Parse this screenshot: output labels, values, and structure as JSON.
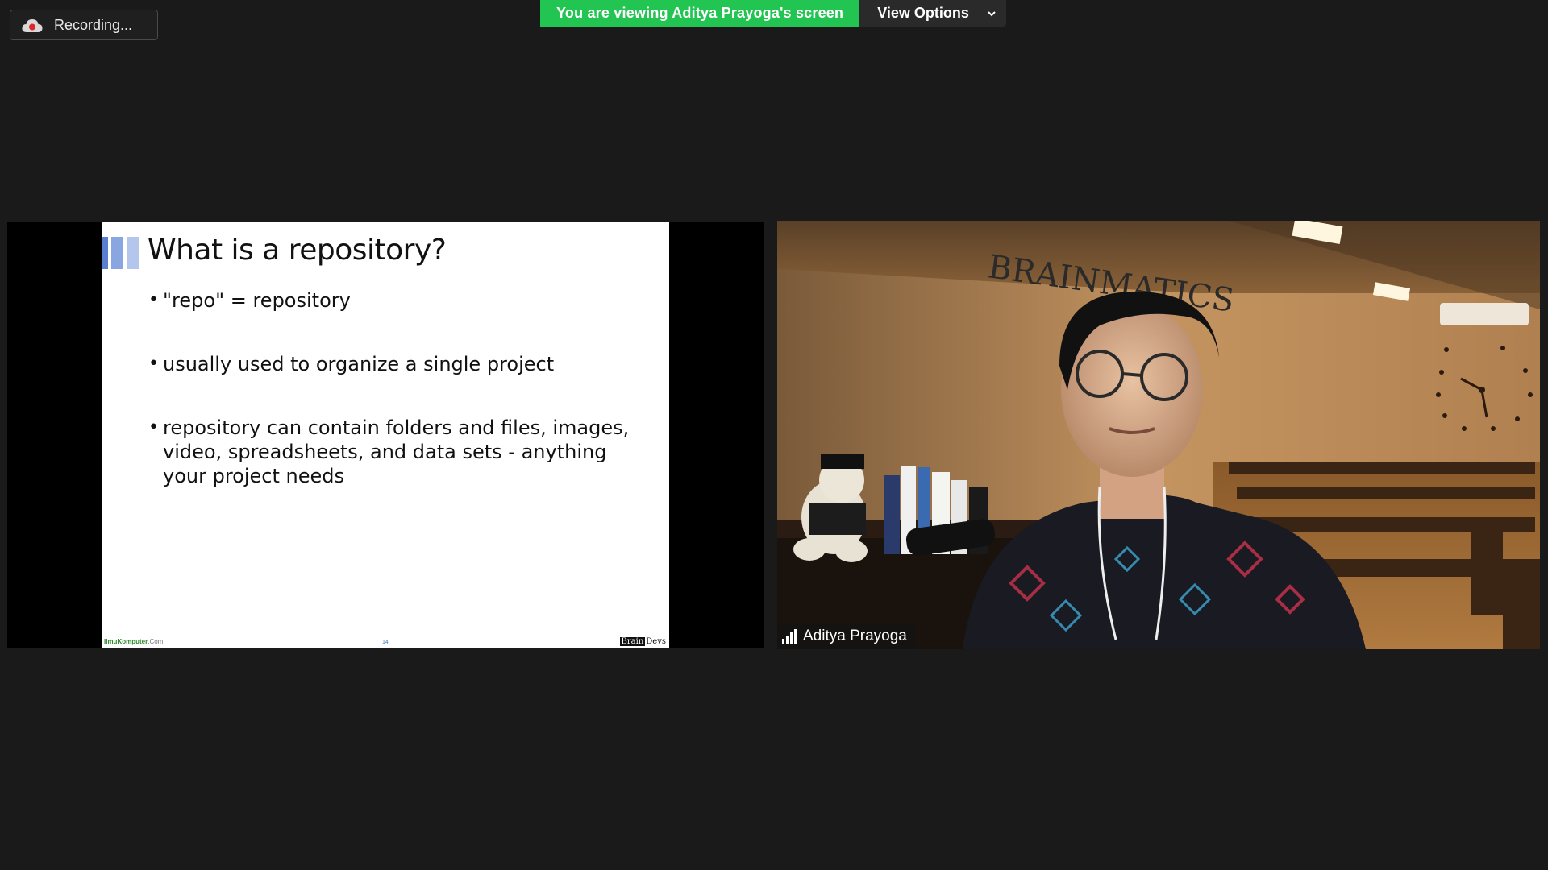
{
  "recording": {
    "label": "Recording..."
  },
  "banner": {
    "message": "You are viewing Aditya Prayoga's screen",
    "view_options_label": "View Options"
  },
  "colors": {
    "banner_green": "#23c552",
    "background": "#1a1a1a"
  },
  "slide": {
    "title": "What is a repository?",
    "bullets": [
      "\"repo\" = repository",
      "usually used to organize a single project",
      "repository can contain folders and files, images, video, spreadsheets, and data sets - anything your project needs"
    ],
    "footer_left": "IlmuKomputer",
    "footer_left_suffix": ".Com",
    "page_number": "14",
    "footer_right_a": "Brain",
    "footer_right_b": "Devs"
  },
  "video": {
    "participant_name": "Aditya Prayoga",
    "wall_sign": "BRAINMATICS"
  }
}
